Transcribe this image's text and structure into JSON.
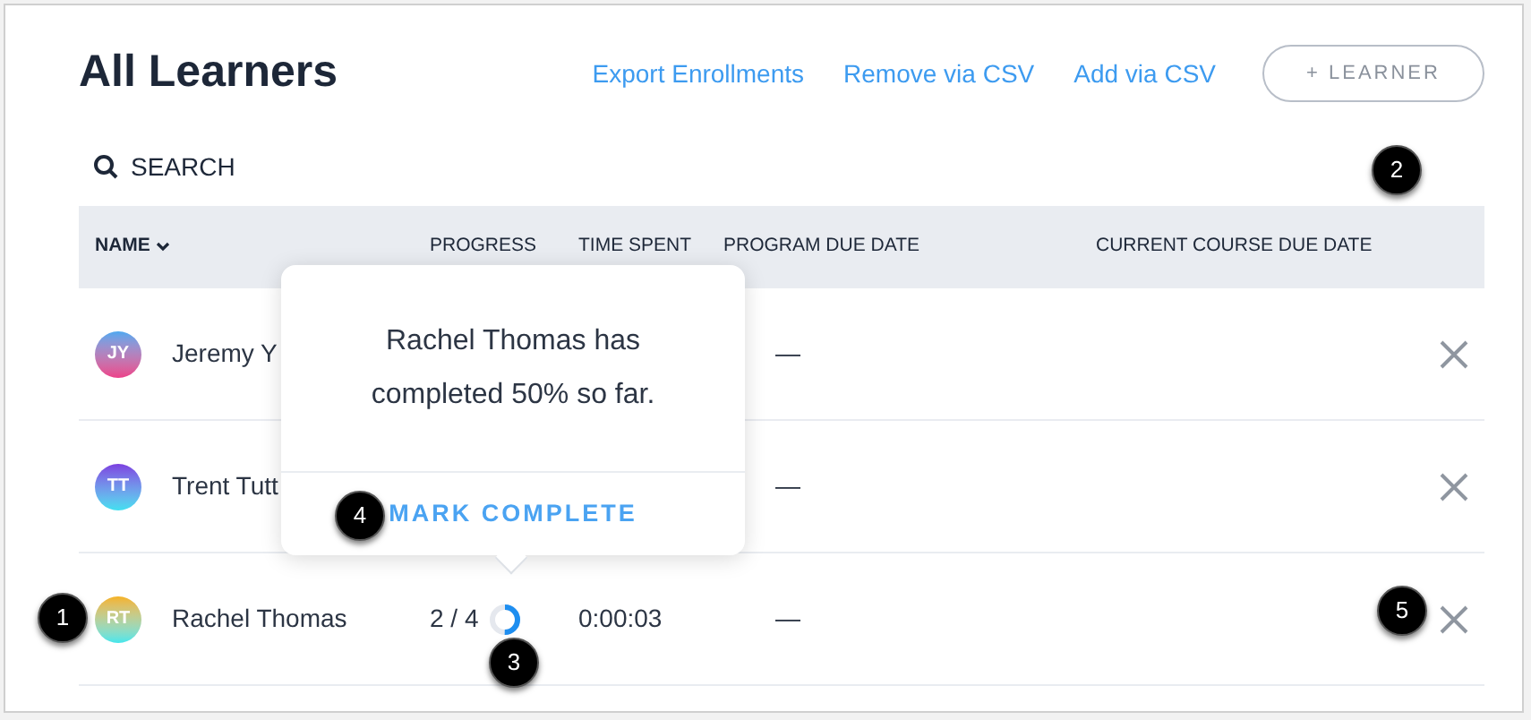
{
  "title": "All Learners",
  "links": [
    "Export Enrollments",
    "Remove via CSV",
    "Add via CSV"
  ],
  "add_button": "+ LEARNER",
  "search": {
    "label": "SEARCH"
  },
  "table": {
    "columns": [
      {
        "label": "NAME",
        "sorted": true
      },
      {
        "label": "PROGRESS",
        "sorted": false
      },
      {
        "label": "TIME SPENT",
        "sorted": false
      },
      {
        "label": "PROGRAM DUE DATE",
        "sorted": false
      },
      {
        "label": "CURRENT COURSE DUE DATE",
        "sorted": false
      }
    ],
    "rows": [
      {
        "initials": "JY",
        "name": "Jeremy Y",
        "program_due": "—"
      },
      {
        "initials": "TT",
        "name": "Trent Tutt",
        "program_due": "—"
      },
      {
        "initials": "RT",
        "name": "Rachel Thomas",
        "progress": "2 / 4",
        "level": 0.5,
        "time_spent": "0:00:03",
        "program_due": "—"
      }
    ]
  },
  "popover": {
    "message": "Rachel Thomas has completed 50% so far.",
    "action": "MARK COMPLETE"
  },
  "callouts": [
    "1",
    "2",
    "3",
    "4",
    "5"
  ]
}
